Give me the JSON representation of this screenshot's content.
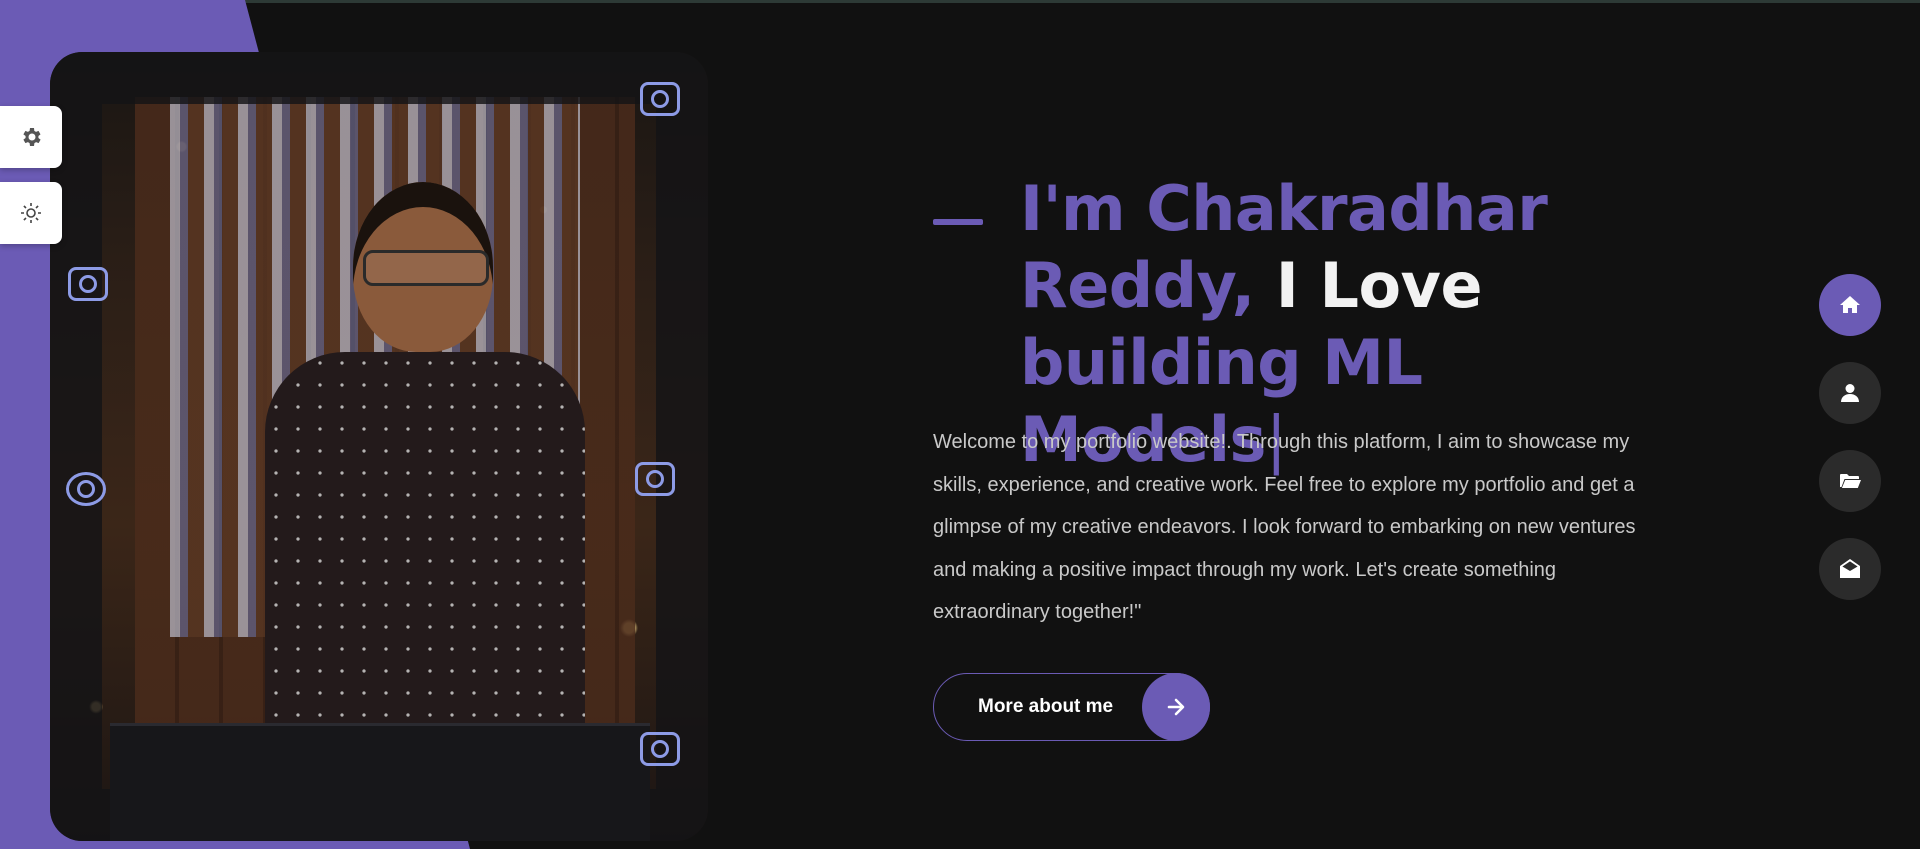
{
  "theme": {
    "accent": "#6b5bb5",
    "background": "#111111",
    "text_muted": "#c9c9c9"
  },
  "profile_photo": {
    "alt": "Portrait photo of Chakradhar Reddy smiling in a decorated camera-themed photo frame"
  },
  "side_tools": [
    {
      "name": "settings",
      "icon": "gear-icon"
    },
    {
      "name": "theme-toggle",
      "icon": "sun-icon"
    }
  ],
  "hero": {
    "heading_part1": "I'm Chakradhar",
    "heading_part2": "Reddy,",
    "heading_part3": " I Love",
    "heading_part4": "building ML Models",
    "cursor": "|",
    "intro": "Welcome to my portfolio website!. Through this platform, I aim to showcase my skills, experience, and creative work. Feel free to explore my portfolio and get a glimpse of my creative endeavors. I look forward to embarking on new ventures and making a positive impact through my work. Let's create something extraordinary together!\"",
    "cta_label": "More about me"
  },
  "right_nav": [
    {
      "name": "home",
      "icon": "home-icon",
      "active": true
    },
    {
      "name": "about",
      "icon": "user-icon",
      "active": false
    },
    {
      "name": "portfolio",
      "icon": "folder-open-icon",
      "active": false
    },
    {
      "name": "contact",
      "icon": "envelope-open-icon",
      "active": false
    }
  ]
}
